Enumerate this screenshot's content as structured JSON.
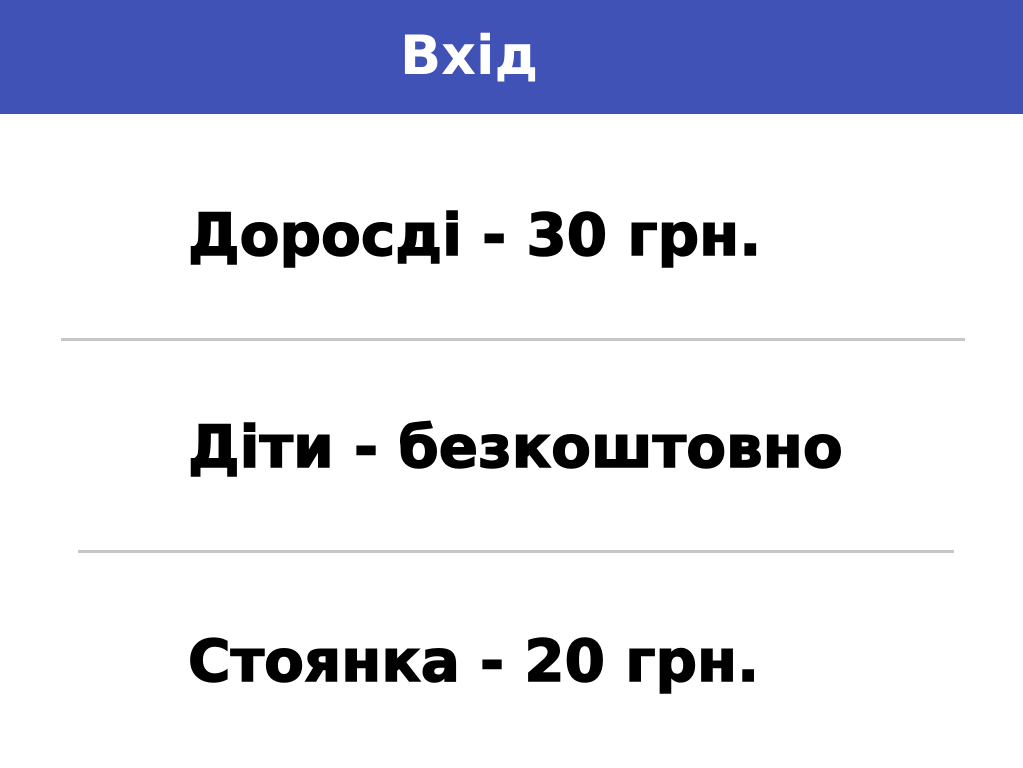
{
  "header": {
    "title": "Вхід"
  },
  "prices": {
    "adults": "Доросдi - 30 грн.",
    "children": "Діти - безкоштовно",
    "parking": "Стоянка - 20 грн."
  },
  "colors": {
    "header_background": "#4152b6",
    "header_text": "#ffffff",
    "body_text": "#000000",
    "divider": "#c6c6c6"
  }
}
